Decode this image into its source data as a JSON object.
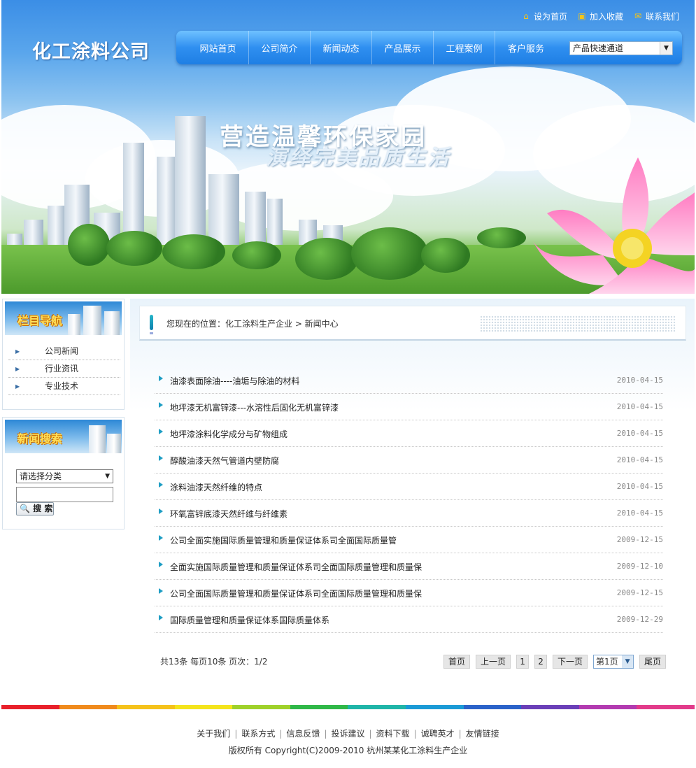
{
  "header": {
    "logo": "化工涂料公司",
    "top_links": [
      {
        "label": "设为首页",
        "icon": "home-icon"
      },
      {
        "label": "加入收藏",
        "icon": "favorite-icon"
      },
      {
        "label": "联系我们",
        "icon": "mail-icon"
      }
    ],
    "nav": [
      "网站首页",
      "公司简介",
      "新闻动态",
      "产品展示",
      "工程案例",
      "客户服务"
    ],
    "quick_select": "产品快速通道",
    "slogan_line1": "营造温馨环保家园",
    "slogan_line2": "演绎完美品质生活"
  },
  "sidebar": {
    "nav_title": "栏目导航",
    "nav_items": [
      "公司新闻",
      "行业资讯",
      "专业技术"
    ],
    "search_title": "新闻搜索",
    "category_select": "请选择分类",
    "search_button": "搜 索"
  },
  "breadcrumb": {
    "text": "您现在的位置：化工涂料生产企业  > 新闻中心"
  },
  "news": [
    {
      "title": "油漆表面除油----油垢与除油的材料",
      "date": "2010-04-15"
    },
    {
      "title": "地坪漆无机富锌漆---水溶性后固化无机富锌漆",
      "date": "2010-04-15"
    },
    {
      "title": "地坪漆涂料化学成分与矿物组成",
      "date": "2010-04-15"
    },
    {
      "title": "醇酸油漆天然气管道内壁防腐",
      "date": "2010-04-15"
    },
    {
      "title": "涂料油漆天然纤维的特点",
      "date": "2010-04-15"
    },
    {
      "title": "环氧富锌底漆天然纤维与纤维素",
      "date": "2010-04-15"
    },
    {
      "title": "公司全面实施国际质量管理和质量保证体系司全面国际质量管",
      "date": "2009-12-15"
    },
    {
      "title": "全面实施国际质量管理和质量保证体系司全面国际质量管理和质量保",
      "date": "2009-12-10"
    },
    {
      "title": "公司全面国际质量管理和质量保证体系司全面国际质量管理和质量保",
      "date": "2009-12-15"
    },
    {
      "title": "国际质量管理和质量保证体系国际质量体系",
      "date": "2009-12-29"
    }
  ],
  "pager": {
    "info": "共13条  每页10条  页次：1/2",
    "first": "首页",
    "prev": "上一页",
    "pages": [
      "1",
      "2"
    ],
    "next": "下一页",
    "page_select": "第1页",
    "last": "尾页"
  },
  "footer": {
    "links": [
      "关于我们",
      "联系方式",
      "信息反馈",
      "投诉建议",
      "资料下载",
      "诚聘英才",
      "友情链接"
    ],
    "copyright": "版权所有  Copyright(C)2009-2010 杭州某某化工涂料生产企业"
  },
  "colors": {
    "nav_blue": "#2f8ff0",
    "accent_teal": "#1f9ec4",
    "rainbow": [
      "#e8202a",
      "#f08a1c",
      "#f5c21a",
      "#f4e41c",
      "#9fd12a",
      "#2fb848",
      "#1fb5a8",
      "#1a9ad6",
      "#2a62c9",
      "#6a3fb8",
      "#b23ab0",
      "#e23a8a"
    ]
  }
}
